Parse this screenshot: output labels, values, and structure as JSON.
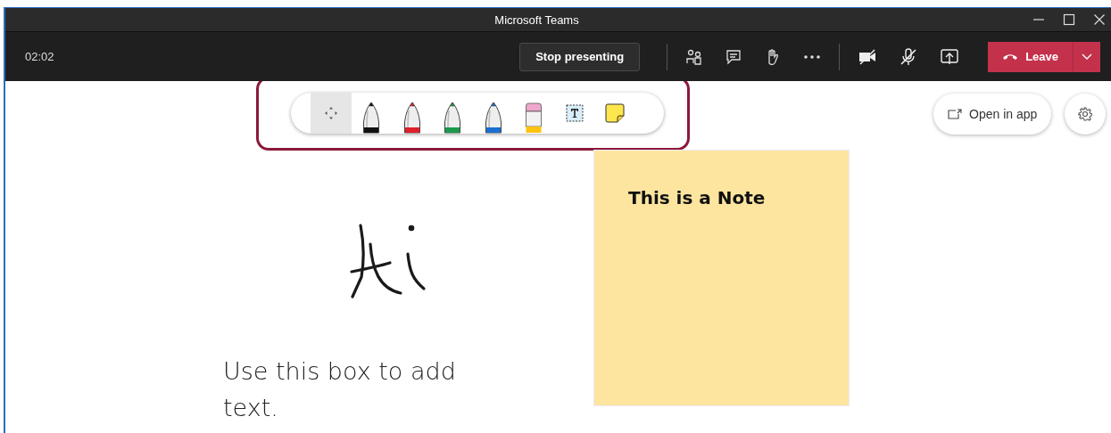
{
  "window": {
    "title": "Microsoft Teams"
  },
  "meeting_bar": {
    "timer": "02:02",
    "stop_button": "Stop presenting",
    "camera_on": false,
    "mic_on": false,
    "leave_button": "Leave"
  },
  "whiteboard_toolbar": {
    "tools": [
      {
        "kind": "move",
        "selected": true
      },
      {
        "kind": "pen",
        "color": "#111111",
        "selected": false
      },
      {
        "kind": "pen",
        "color": "#e0202a",
        "selected": false
      },
      {
        "kind": "pen",
        "color": "#1a9a4a",
        "selected": false
      },
      {
        "kind": "pen",
        "color": "#1a6fd0",
        "selected": false
      },
      {
        "kind": "eraser",
        "selected": false
      },
      {
        "kind": "text",
        "selected": false
      },
      {
        "kind": "note",
        "selected": false
      }
    ]
  },
  "open_in_app_button": "Open in app",
  "canvas": {
    "note": "This is a Note",
    "text_box": "Use this box to add text."
  }
}
